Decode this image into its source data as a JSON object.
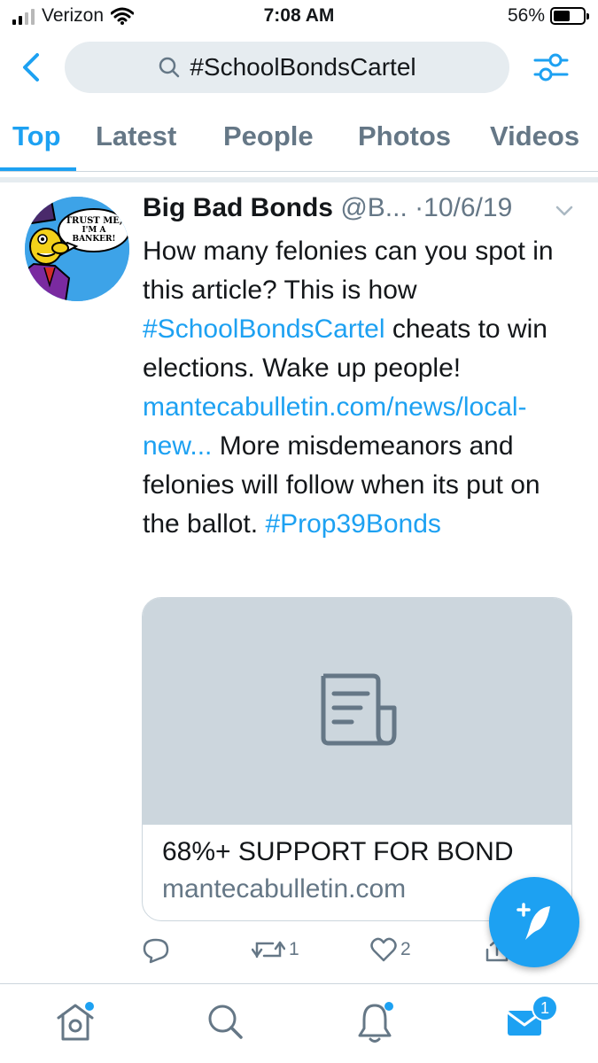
{
  "status_bar": {
    "carrier": "Verizon",
    "time": "7:08 AM",
    "battery": "56%",
    "battery_level": 0.56
  },
  "search": {
    "query": "#SchoolBondsCartel"
  },
  "tabs": [
    {
      "label": "Top",
      "active": true
    },
    {
      "label": "Latest",
      "active": false
    },
    {
      "label": "People",
      "active": false
    },
    {
      "label": "Photos",
      "active": false
    },
    {
      "label": "Videos",
      "active": false
    }
  ],
  "tweet": {
    "author_name": "Big Bad Bonds",
    "handle": "@B...",
    "separator": "·",
    "date": "10/6/19",
    "avatar_text": {
      "line1": "TRUST ME,",
      "line2": "I'M A",
      "line3": "BANKER!"
    },
    "text": {
      "part1": "How many felonies can you spot in this article? This is how ",
      "hashtag1": "#SchoolBondsCartel",
      "part2": " cheats to win elections. Wake up people! ",
      "url": "mantecabulletin.com/news/local-new...",
      "part3": " More misdemeanors and felonies will follow when its put on the ballot. ",
      "hashtag2": "#Prop39Bonds"
    },
    "card": {
      "title": "68%+ SUPPORT FOR BOND",
      "domain": "mantecabulletin.com"
    },
    "retweet_count": "1",
    "like_count": "2"
  },
  "notifications": {
    "messages_badge": "1"
  },
  "colors": {
    "accent": "#1da1f2",
    "muted": "#657786",
    "card_bg": "#ccd6dd",
    "search_bg": "#e6ecf0"
  }
}
